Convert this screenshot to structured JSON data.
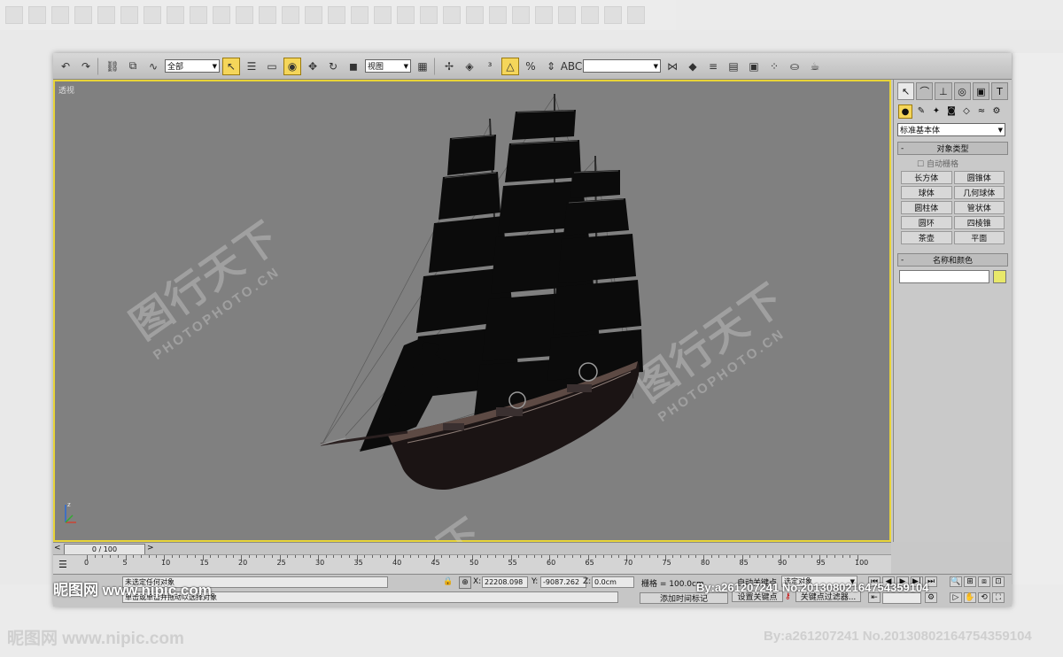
{
  "toolbar": {
    "selection_filter": "全部",
    "ref_coord": "视图",
    "named_selection": ""
  },
  "viewport": {
    "label": "透视",
    "watermark_cn": "图行天下",
    "watermark_en": "PHOTOPHOTO.CN"
  },
  "command_panel": {
    "category": "标准基本体",
    "object_type_title": "对象类型",
    "autogrid_label": "自动栅格",
    "primitives": [
      "长方体",
      "圆锥体",
      "球体",
      "几何球体",
      "圆柱体",
      "管状体",
      "圆环",
      "四棱锥",
      "茶壶",
      "平面"
    ],
    "name_color_title": "名称和颜色",
    "object_name": "",
    "swatch_color": "#e8e86a"
  },
  "timeline": {
    "frame_display": "0 / 100",
    "ticks": [
      0,
      5,
      10,
      15,
      20,
      25,
      30,
      35,
      40,
      45,
      50,
      55,
      60,
      65,
      70,
      75,
      80,
      85,
      90,
      95,
      100
    ]
  },
  "status": {
    "line1": "未选定任何对象",
    "line2": "单击或单击并拖动以选择对象",
    "x_label": "X:",
    "x_value": "22208.098",
    "y_label": "Y:",
    "y_value": "-9087.262",
    "z_label": "Z:",
    "z_value": "0.0cm",
    "grid_label": "栅格 = 100.0cm",
    "add_time_tag": "添加时间标记",
    "auto_key": "自动关键点",
    "selected_obj": "选定对象",
    "set_key": "设置关键点",
    "key_filters": "关键点过滤器..."
  },
  "watermark": {
    "site": "昵图网 www.nipic.com",
    "byline": "By:a261207241 No.20130802164754359104"
  }
}
